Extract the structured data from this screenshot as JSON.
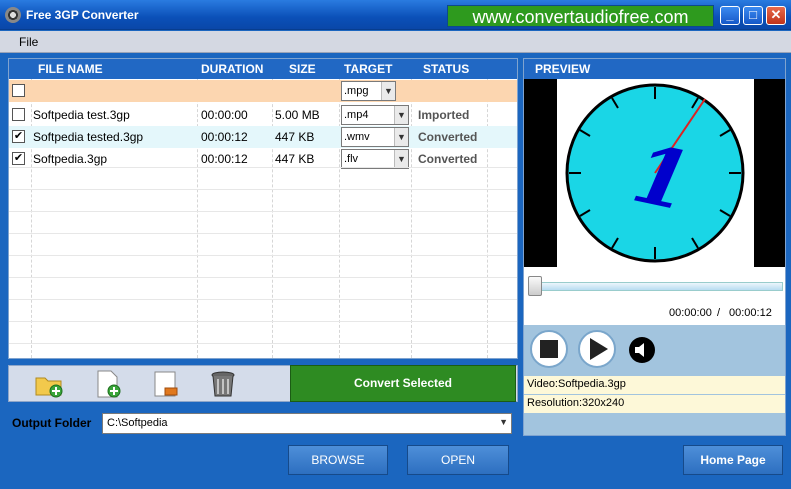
{
  "window": {
    "title": "Free 3GP Converter",
    "banner": "www.convertaudiofree.com",
    "minimize": "_",
    "maximize": "□",
    "close": "✕"
  },
  "menu": {
    "file": "File"
  },
  "grid": {
    "headers": {
      "file_name": "FILE NAME",
      "duration": "DURATION",
      "size": "SIZE",
      "target": "TARGET",
      "status": "STATUS"
    },
    "filter_target": ".mpg",
    "rows": [
      {
        "checked": false,
        "file_name": "Softpedia test.3gp",
        "duration": "00:00:00",
        "size": "5.00 MB",
        "target": ".mp4",
        "status": "Imported"
      },
      {
        "checked": true,
        "file_name": "Softpedia tested.3gp",
        "duration": "00:00:12",
        "size": "447 KB",
        "target": ".wmv",
        "status": "Converted"
      },
      {
        "checked": true,
        "file_name": "Softpedia.3gp",
        "duration": "00:00:12",
        "size": "447 KB",
        "target": ".flv",
        "status": "Converted"
      }
    ]
  },
  "toolbar": {
    "icons": [
      "add-folder-icon",
      "add-file-icon",
      "remove-file-icon",
      "trash-icon"
    ],
    "convert_label": "Convert Selected"
  },
  "output": {
    "label": "Output Folder",
    "path": "C:\\Softpedia"
  },
  "buttons": {
    "browse": "BROWSE",
    "open": "OPEN",
    "home": "Home Page"
  },
  "preview": {
    "title": "PREVIEW",
    "current_time": "00:00:00",
    "separator": "/",
    "total_time": "00:00:12",
    "video_label": "Video:Softpedia.3gp",
    "resolution_label": "Resolution:320x240",
    "frame_digit": "1"
  },
  "colors": {
    "accent": "#2168c4",
    "convert": "#2e8b22",
    "clock_face": "#1ad6e6",
    "filter_row": "#fcd6b0"
  }
}
